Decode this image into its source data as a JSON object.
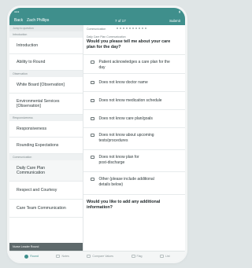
{
  "navbar": {
    "back_label": "Back",
    "patient_name": "Zach Phillips",
    "position": "7 of 17",
    "submit_label": "Submit"
  },
  "sidebar": {
    "search_placeholder": "Jump to question",
    "sections": [
      {
        "header": "Introduction",
        "items": [
          "Introduction",
          "Ability to Round"
        ]
      },
      {
        "header": "Observation",
        "items": [
          "White Board [Observation]",
          "Environmental Services [Observation]"
        ]
      },
      {
        "header": "Responsiveness",
        "items": [
          "Responsiveness",
          "Rounding Expectations"
        ]
      },
      {
        "header": "Communication",
        "items": [
          "Daily Care Plan Communication",
          "Respect and Courtesy",
          "Care Team Communication"
        ]
      }
    ],
    "bottom_bar": "Nurse Leader Round"
  },
  "main": {
    "breadcrumb": "Communication",
    "subheading": "Daily Care Plan Communication",
    "question": "Would you please tell me about your care plan for the day?",
    "options": [
      "Patient acknowledges a care plan for the day",
      "Does not know doctor name",
      "Does not know medication schedule",
      "Does not know care plan/goals",
      "Does not know about upcoming tests/procedures",
      "Does not know plan for post-discharge",
      "Other (please include additional details below)"
    ],
    "followup_question": "Would you like to add any additional information?"
  },
  "tabs": [
    {
      "label": "Round",
      "icon": "round-icon",
      "active": true
    },
    {
      "label": "Notes",
      "icon": "notes-icon",
      "active": false
    },
    {
      "label": "Compare Values",
      "icon": "compare-icon",
      "active": false
    },
    {
      "label": "Flag",
      "icon": "flag-icon",
      "active": false
    },
    {
      "label": "List",
      "icon": "list-icon",
      "active": false
    }
  ],
  "colors": {
    "accent": "#3f8f8c",
    "sidebar_section_bg": "#eef1f2",
    "bottom_bar_bg": "#5e696b"
  }
}
